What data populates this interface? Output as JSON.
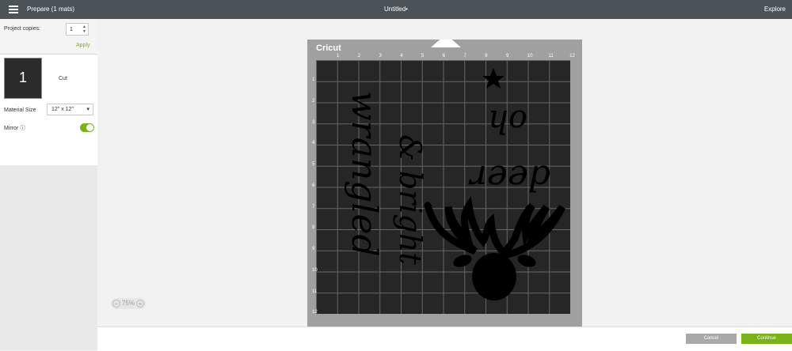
{
  "topbar": {
    "title": "Prepare (1 mats)",
    "document": "Untitled•",
    "explore": "Explore"
  },
  "project": {
    "copies_label": "Project copies:",
    "copies_value": "1",
    "apply": "Apply"
  },
  "mat": {
    "thumbnail_number": "1",
    "cut_label": "Cut",
    "material_size_label": "Material Size",
    "material_size_value": "12\" x 12\"",
    "mirror_label": "Mirror",
    "mirror_on": true,
    "brand": "Cricut",
    "grid_numbers": [
      "1",
      "2",
      "3",
      "4",
      "5",
      "6",
      "7",
      "8",
      "9",
      "10",
      "11",
      "12"
    ]
  },
  "zoom": {
    "value": "75%",
    "minus": "−",
    "plus": "+"
  },
  "footer": {
    "cancel": "Cancel",
    "continue": "Continue"
  },
  "colors": {
    "accent": "#7ab317",
    "topbar": "#4b5358",
    "mat": "#a0a0a0",
    "grid": "#262626"
  }
}
